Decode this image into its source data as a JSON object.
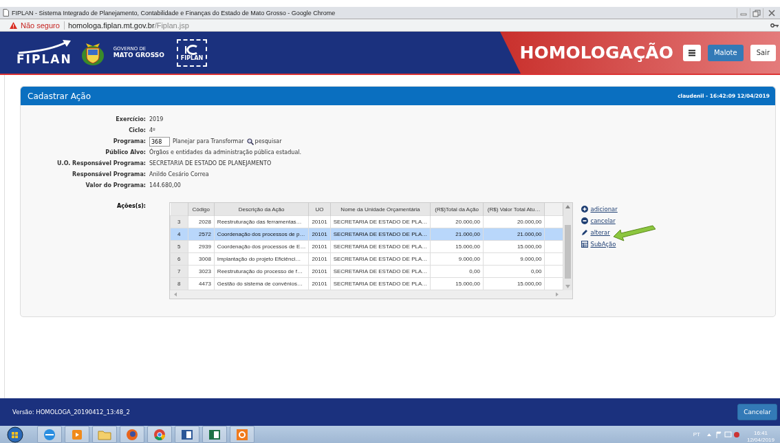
{
  "browser": {
    "title": "FIPLAN - Sistema Integrado de Planejamento, Contabilidade e Finanças do Estado de Mato Grosso - Google Chrome",
    "security": "Não seguro",
    "url_host": "homologa.fiplan.mt.gov.br",
    "url_path": "/Fiplan.jsp"
  },
  "header": {
    "logo": "FIPLAN",
    "gov_small": "GOVERNO DE",
    "gov": "MATO GROSSO",
    "badge": "FIPLAN",
    "environment": "HOMOLOGAÇÃO",
    "buttons": [
      {
        "kind": "menu"
      },
      {
        "kind": "primary",
        "label": "Malote"
      },
      {
        "kind": "default",
        "label": "Sair"
      }
    ]
  },
  "panel": {
    "title": "Cadastrar Ação",
    "user_time": "claudenil - 16:42:09 12/04/2019",
    "fields": [
      {
        "kind": "text",
        "label": "Exercício:",
        "value": "2019"
      },
      {
        "kind": "text",
        "label": "Ciclo:",
        "value": "4º"
      },
      {
        "kind": "program",
        "label": "Programa:",
        "value": "368",
        "name": "Planejar para Transformar",
        "link": "pesquisar"
      },
      {
        "kind": "text",
        "label": "Público Alvo:",
        "value": "Órgãos e entidades da administração pública estadual."
      },
      {
        "kind": "text",
        "label": "U.O. Responsável Programa:",
        "value": "SECRETARIA DE ESTADO DE PLANEJAMENTO"
      },
      {
        "kind": "text",
        "label": "Responsável Programa:",
        "value": "Anildo Cesário Correa"
      },
      {
        "kind": "text",
        "label": "Valor do Programa:",
        "value": "144.680,00"
      }
    ],
    "table_label": "Ações(s):",
    "table": {
      "columns": [
        "Código",
        "Descrição da Ação",
        "UO",
        "Nome da Unidade Orçamentária",
        "(R$)Total da Ação",
        "(R$) Valor Total Atu…"
      ],
      "rows": [
        {
          "n": "3",
          "cells": [
            "2028",
            "Reestruturação das ferramentas…",
            "20101",
            "SECRETARIA DE ESTADO DE PLA…",
            "20.000,00",
            "20.000,00"
          ],
          "selected": false
        },
        {
          "n": "4",
          "cells": [
            "2572",
            "Coordenação dos processos de p…",
            "20101",
            "SECRETARIA DE ESTADO DE PLA…",
            "21.000,00",
            "21.000,00"
          ],
          "selected": true
        },
        {
          "n": "5",
          "cells": [
            "2939",
            "Coordenação dos processos de E…",
            "20101",
            "SECRETARIA DE ESTADO DE PLA…",
            "15.000,00",
            "15.000,00"
          ],
          "selected": false
        },
        {
          "n": "6",
          "cells": [
            "3008",
            "Implantação do projeto Eficiênci…",
            "20101",
            "SECRETARIA DE ESTADO DE PLA…",
            "9.000,00",
            "9.000,00"
          ],
          "selected": false
        },
        {
          "n": "7",
          "cells": [
            "3023",
            "Reestruturação do processo de f…",
            "20101",
            "SECRETARIA DE ESTADO DE PLA…",
            "0,00",
            "0,00"
          ],
          "selected": false
        },
        {
          "n": "8",
          "cells": [
            "4473",
            "Gestão do sistema de convênios…",
            "20101",
            "SECRETARIA DE ESTADO DE PLA…",
            "15.000,00",
            "15.000,00"
          ],
          "selected": false
        }
      ]
    },
    "actions": [
      {
        "kind": "add",
        "label": "adicionar"
      },
      {
        "kind": "cancel",
        "label": "cancelar"
      },
      {
        "kind": "edit",
        "label": "alterar",
        "pointed": true
      },
      {
        "kind": "sub",
        "label": "SubAção"
      }
    ]
  },
  "footer": {
    "version": "Versão: HOMOLOGA_20190412_13:48_2",
    "button": "Cancelar"
  },
  "taskbar": {
    "language": "PT",
    "time": "16:41",
    "date": "12/04/2019"
  }
}
